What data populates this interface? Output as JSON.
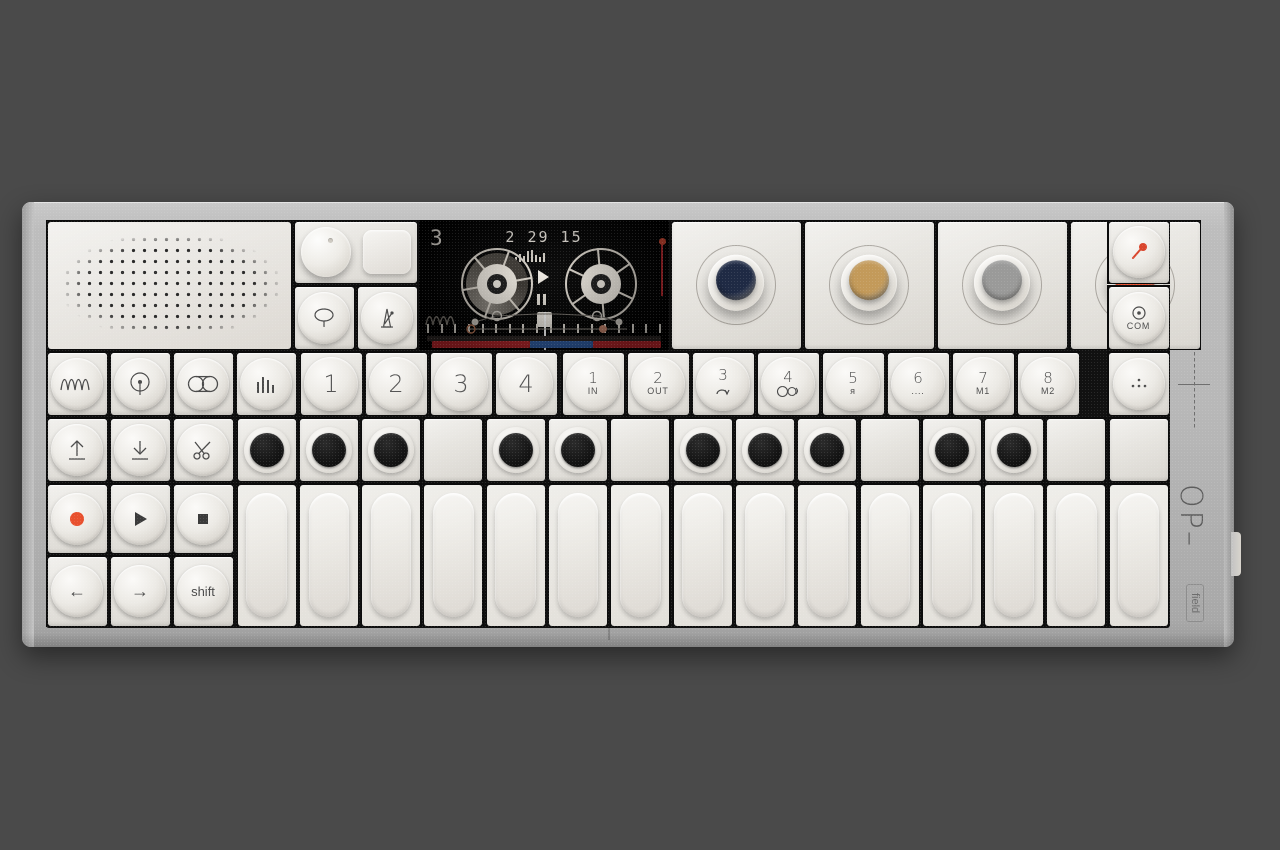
{
  "device": {
    "brand": "OP–1",
    "edition": "field",
    "chassis_color": "#b7b7b7",
    "background_color": "#4a4a4a"
  },
  "display": {
    "pattern_number": "3",
    "timecode": "2 29 15",
    "mode_icon": "synth-wave-icon",
    "transport_state": "play",
    "tracks": [
      {
        "index": 1,
        "color": "#b8252a",
        "start_pct": 2,
        "width_pct": 42
      },
      {
        "index": 2,
        "color": "#2f5fa8",
        "start_pct": 44,
        "width_pct": 27
      },
      {
        "index": 3,
        "color": "#b8252a",
        "start_pct": 71,
        "width_pct": 25
      },
      {
        "index": 4,
        "color": "#b8252a",
        "start_pct": 96,
        "width_pct": 4
      }
    ],
    "playhead_pct": 50,
    "level_marker_color": "#c0392b"
  },
  "speaker": {
    "name": "Speaker grille"
  },
  "top_controls": {
    "volume_knob": "volume-knob",
    "blank_pad": "blank-pad",
    "help_key": "help-key",
    "metronome_key": "metronome-key"
  },
  "encoders": [
    {
      "name": "encoder-blue",
      "color": "#1f2a44"
    },
    {
      "name": "encoder-gold",
      "color": "#c39a5a"
    },
    {
      "name": "encoder-gray",
      "color": "#9a9a99"
    },
    {
      "name": "encoder-orange",
      "color": "#e8502e"
    }
  ],
  "right_keys": {
    "mic": {
      "label": "",
      "icon": "mic-icon",
      "color": "#d9452c"
    },
    "com": {
      "label": "COM",
      "icon": "com-dot-icon"
    },
    "sequencer": {
      "label": "",
      "icon": "dots-icon"
    }
  },
  "function_row_1": [
    {
      "name": "synth-key",
      "icon": "waveform-icon"
    },
    {
      "name": "drum-key",
      "icon": "drum-circle-icon"
    },
    {
      "name": "tape-key",
      "icon": "tape-reels-icon"
    },
    {
      "name": "mixer-key",
      "icon": "mixer-bars-icon"
    }
  ],
  "function_row_2": [
    {
      "name": "lift-key",
      "icon": "arrow-up-bar-icon"
    },
    {
      "name": "drop-key",
      "icon": "arrow-down-bar-icon"
    },
    {
      "name": "scissors-key",
      "icon": "scissors-icon"
    }
  ],
  "transport": [
    {
      "name": "record-button",
      "icon": "record-dot-icon",
      "color": "#e8502e"
    },
    {
      "name": "play-button",
      "icon": "play-triangle-icon"
    },
    {
      "name": "stop-button",
      "icon": "stop-square-icon"
    }
  ],
  "nav_row": [
    {
      "name": "arrow-left-key",
      "label": "←"
    },
    {
      "name": "arrow-right-key",
      "label": "→"
    },
    {
      "name": "shift-key",
      "label": "shift"
    }
  ],
  "track_keys": [
    {
      "number": "1"
    },
    {
      "number": "2"
    },
    {
      "number": "3"
    },
    {
      "number": "4"
    }
  ],
  "numbered_keys": [
    {
      "number": "1",
      "sub": "IN",
      "icon": ""
    },
    {
      "number": "2",
      "sub": "OUT",
      "icon": ""
    },
    {
      "number": "3",
      "sub": "",
      "icon": "loop-icon"
    },
    {
      "number": "4",
      "sub": "",
      "icon": "tape-small-icon"
    },
    {
      "number": "5",
      "sub": "я",
      "icon": ""
    },
    {
      "number": "6",
      "sub": "....",
      "icon": ""
    },
    {
      "number": "7",
      "sub": "M1",
      "icon": ""
    },
    {
      "number": "8",
      "sub": "M2",
      "icon": ""
    }
  ],
  "keyboard": {
    "white_key_count": 15,
    "black_key_pattern": [
      1,
      1,
      1,
      0,
      1,
      1,
      0,
      1,
      1,
      1,
      0,
      1,
      1,
      0
    ]
  }
}
